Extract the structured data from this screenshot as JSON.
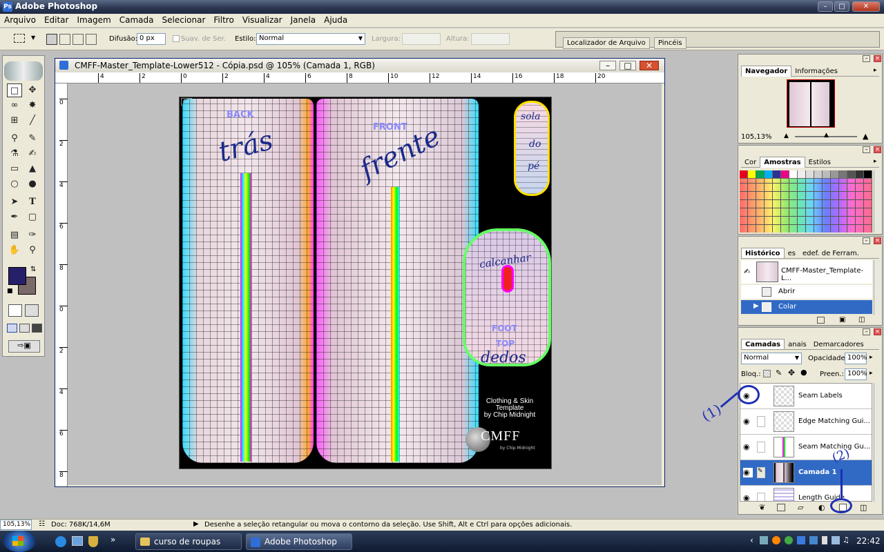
{
  "app": {
    "title": "Adobe Photoshop"
  },
  "menu": [
    "Arquivo",
    "Editar",
    "Imagem",
    "Camada",
    "Selecionar",
    "Filtro",
    "Visualizar",
    "Janela",
    "Ajuda"
  ],
  "options": {
    "feather_label": "Difusão:",
    "feather_value": "0 px",
    "antialias_label": "Suav. de Ser.",
    "style_label": "Estilo:",
    "style_value": "Normal",
    "width_label": "Largura:",
    "height_label": "Altura:",
    "well_tabs": [
      "Localizador de Arquivo",
      "Pincéis"
    ]
  },
  "document": {
    "title": "CMFF-Master_Template-Lower512 - Cópia.psd @ 105% (Camada 1, RGB)",
    "ruler_h": [
      "4",
      "2",
      "0",
      "2",
      "4",
      "6",
      "8",
      "10",
      "12",
      "14",
      "16",
      "18",
      "20"
    ],
    "ruler_v": [
      "0",
      "2",
      "4",
      "6",
      "8",
      "0",
      "2",
      "4",
      "6",
      "8"
    ],
    "layer_badge": "01",
    "art_labels": {
      "back": "BACK",
      "tras": "trás",
      "front": "FRONT",
      "frente": "frente",
      "sola1": "sola",
      "sola2": "do",
      "sola3": "pé",
      "calcanhar": "calcanhar",
      "foot": "FOOT",
      "top": "TOP",
      "dedos": "dedos",
      "credit1": "Clothing & Skin",
      "credit2": "Template",
      "credit3": "by Chip Midnight",
      "logo": "CMFF",
      "logo_sub": "by Chip Midnight"
    }
  },
  "navigator": {
    "tabs": [
      "Navegador",
      "Informações"
    ],
    "zoom": "105,13%"
  },
  "swatches_panel": {
    "tabs": [
      "Cor",
      "Amostras",
      "Estilos"
    ],
    "colors": [
      "#e8001c",
      "#00a651",
      "#00b0f0",
      "#2e3192",
      "#ec008c",
      "#fff200",
      "#ffffff",
      "#ffffff",
      "#ffffff",
      "#ffffff",
      "#ffffff",
      "#ffffff",
      "#ffffff",
      "#ffffff",
      "#ffffff",
      "#ffffff"
    ]
  },
  "history": {
    "tabs": [
      "Histórico",
      "es",
      "edef. de Ferram."
    ],
    "snapshot": "CMFF-Master_Template-L...",
    "items": [
      "Abrir",
      "Colar"
    ]
  },
  "layers": {
    "tabs": [
      "Camadas",
      "anais",
      "Demarcadores"
    ],
    "blend": "Normal",
    "opacity_label": "Opacidade:",
    "opacity": "100%",
    "lock_label": "Bloq.:",
    "fill_label": "Preen.:",
    "fill": "100%",
    "items": [
      "Seam Labels",
      "Edge Matching Gui...",
      "Seam Matching Gu...",
      "Camada 1",
      "Length Guide"
    ]
  },
  "annotations": {
    "one": "(1)",
    "two": "(2)"
  },
  "status": {
    "zoom": "105,13%",
    "doc": "Doc: 768K/14,6M",
    "hint": "Desenhe a seleção retangular ou mova o contorno da seleção. Use Shift, Alt e Ctrl para opções adicionais."
  },
  "taskbar": {
    "tasks": [
      "curso de roupas",
      "Adobe Photoshop"
    ],
    "clock": "22:42"
  }
}
